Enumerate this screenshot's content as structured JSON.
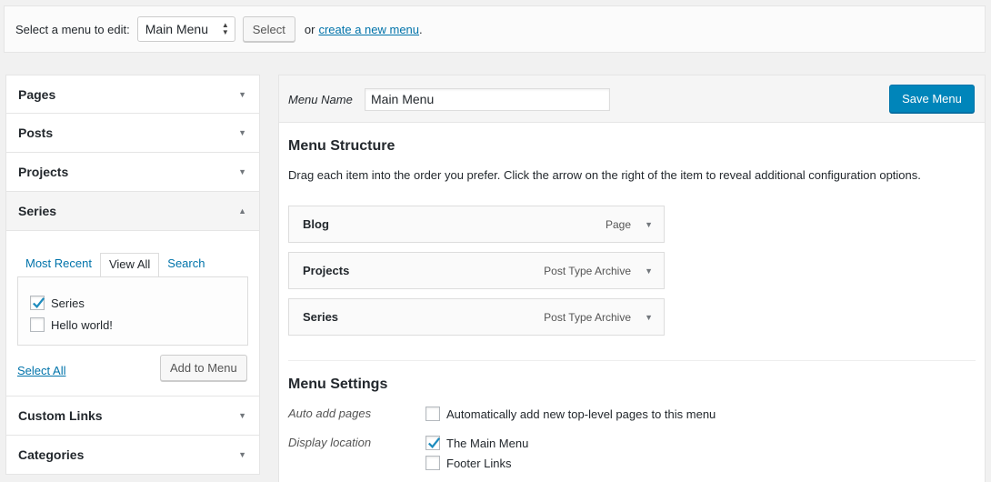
{
  "topbar": {
    "label": "Select a menu to edit:",
    "selected_menu": "Main Menu",
    "select_button": "Select",
    "or_text": "or",
    "create_link": "create a new menu",
    "period": "."
  },
  "sidebar": {
    "sections": [
      {
        "label": "Pages"
      },
      {
        "label": "Posts"
      },
      {
        "label": "Projects"
      },
      {
        "label": "Series"
      },
      {
        "label": "Custom Links"
      },
      {
        "label": "Categories"
      }
    ],
    "series_panel": {
      "tabs": [
        "Most Recent",
        "View All",
        "Search"
      ],
      "active_tab": "View All",
      "items": [
        {
          "label": "Series",
          "checked": true
        },
        {
          "label": "Hello world!",
          "checked": false
        }
      ],
      "select_all": "Select All",
      "add_button": "Add to Menu"
    }
  },
  "menu_editor": {
    "name_label": "Menu Name",
    "name_value": "Main Menu",
    "save_button": "Save Menu",
    "structure_title": "Menu Structure",
    "structure_desc": "Drag each item into the order you prefer. Click the arrow on the right of the item to reveal additional configuration options.",
    "items": [
      {
        "title": "Blog",
        "type": "Page"
      },
      {
        "title": "Projects",
        "type": "Post Type Archive"
      },
      {
        "title": "Series",
        "type": "Post Type Archive"
      }
    ],
    "settings_title": "Menu Settings",
    "auto_add_label": "Auto add pages",
    "auto_add_option": "Automatically add new top-level pages to this menu",
    "auto_add_checked": false,
    "display_location_label": "Display location",
    "locations": [
      {
        "label": "The Main Menu",
        "checked": true
      },
      {
        "label": "Footer Links",
        "checked": false
      }
    ]
  },
  "colors": {
    "primary": "#0085ba",
    "link": "#0073aa"
  }
}
